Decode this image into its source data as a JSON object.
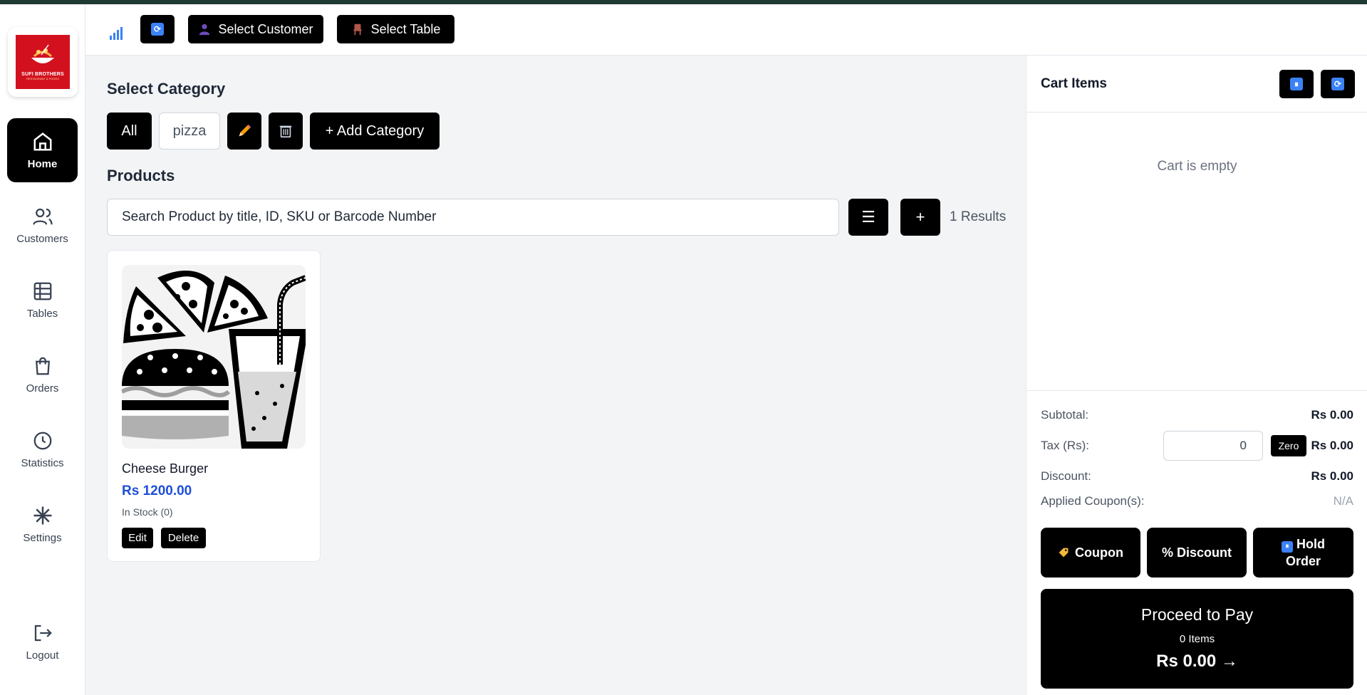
{
  "app": {
    "logo_text": "SUFI BROTHERS",
    "logo_sub": "RESTAURANT & FOODS"
  },
  "sidebar": {
    "items": [
      {
        "label": "Home"
      },
      {
        "label": "Customers"
      },
      {
        "label": "Tables"
      },
      {
        "label": "Orders"
      },
      {
        "label": "Statistics"
      },
      {
        "label": "Settings"
      },
      {
        "label": "Logout"
      }
    ]
  },
  "header": {
    "select_customer": "Select Customer",
    "select_table": "Select Table"
  },
  "category": {
    "title": "Select Category",
    "chips": [
      "All",
      "pizza"
    ],
    "add_label": "+ Add Category"
  },
  "products": {
    "title": "Products",
    "search_placeholder": "Search Product by title, ID, SKU or Barcode Number",
    "menu_glyph": "☰",
    "add_glyph": "+",
    "results": "1 Results",
    "items": [
      {
        "name": "Cheese Burger",
        "price": "Rs 1200.00",
        "stock": "In Stock (0)",
        "edit_label": "Edit",
        "delete_label": "Delete"
      }
    ]
  },
  "cart": {
    "title": "Cart Items",
    "empty_text": "Cart is empty",
    "subtotal_label": "Subtotal:",
    "subtotal_value": "Rs 0.00",
    "tax_label": "Tax (Rs):",
    "tax_input": "0",
    "zero_label": "Zero",
    "tax_value": "Rs 0.00",
    "discount_label": "Discount:",
    "discount_value": "Rs 0.00",
    "coupon_label": "Applied Coupon(s):",
    "coupon_value": "N/A",
    "btn_coupon": "Coupon",
    "btn_discount": "% Discount",
    "btn_hold": "Hold Order",
    "pay_title": "Proceed to Pay",
    "pay_items": "0 Items",
    "pay_total": "Rs 0.00 →"
  },
  "colors": {
    "accent": "#000000",
    "price": "#1d4ed8",
    "icon_blue": "#3b82f6",
    "top_strip": "#1f3a33",
    "logo_red": "#d3111e"
  }
}
